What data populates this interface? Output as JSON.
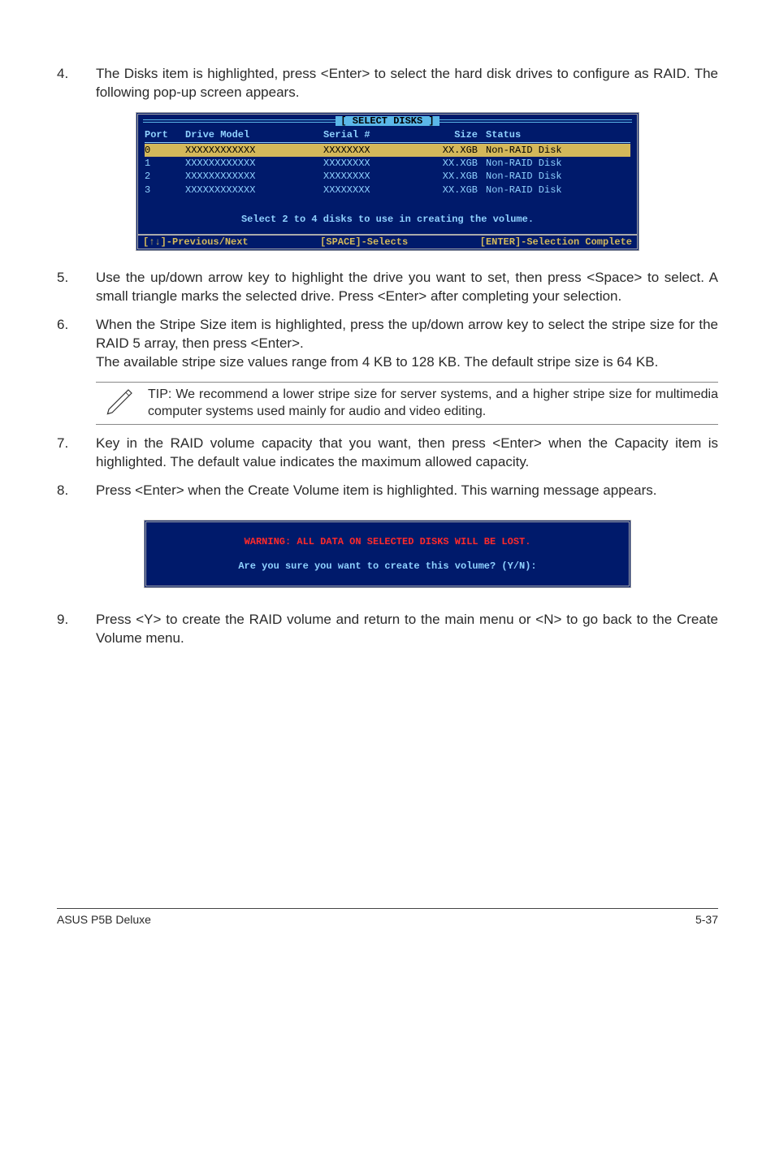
{
  "steps": {
    "s4": {
      "num": "4.",
      "text": "The Disks item is highlighted, press <Enter> to select the hard disk drives to configure as RAID. The following pop-up screen appears."
    },
    "s5": {
      "num": "5.",
      "text": "Use the up/down arrow key to highlight the drive you want to set, then press <Space> to select.  A small triangle marks the selected drive. Press <Enter> after completing your selection."
    },
    "s6": {
      "num": "6.",
      "text": "When the Stripe Size item is highlighted, press the up/down arrow key to select the stripe size for the RAID 5 array, then press <Enter>."
    },
    "s6b": "The available stripe size values range from 4 KB to 128 KB. The default stripe size is 64 KB.",
    "tip": "TIP: We recommend a lower stripe size for server systems, and a higher stripe size for multimedia computer systems used mainly for audio and video editing.",
    "s7": {
      "num": "7.",
      "text": "Key in the RAID volume capacity that you want, then press <Enter> when the Capacity item is highlighted. The default value indicates the maximum allowed capacity."
    },
    "s8": {
      "num": "8.",
      "text": "Press <Enter> when the Create Volume item is highlighted. This warning message appears."
    },
    "s9": {
      "num": "9.",
      "text": "Press <Y> to create the RAID volume and return to the main menu or <N> to go back to the Create Volume menu."
    }
  },
  "terminal": {
    "title": "[ SELECT DISKS ]",
    "headers": {
      "port": "Port",
      "model": "Drive Model",
      "serial": "Serial #",
      "size": "Size",
      "status": "Status"
    },
    "rows": [
      {
        "port": "0",
        "model": "XXXXXXXXXXXX",
        "serial": "XXXXXXXX",
        "size": "XX.XGB",
        "status": "Non-RAID Disk",
        "selected": true
      },
      {
        "port": "1",
        "model": "XXXXXXXXXXXX",
        "serial": "XXXXXXXX",
        "size": "XX.XGB",
        "status": "Non-RAID Disk",
        "selected": false
      },
      {
        "port": "2",
        "model": "XXXXXXXXXXXX",
        "serial": "XXXXXXXX",
        "size": "XX.XGB",
        "status": "Non-RAID Disk",
        "selected": false
      },
      {
        "port": "3",
        "model": "XXXXXXXXXXXX",
        "serial": "XXXXXXXX",
        "size": "XX.XGB",
        "status": "Non-RAID Disk",
        "selected": false
      }
    ],
    "note": "Select 2 to 4 disks to use in creating the volume.",
    "footer": {
      "left": "[↑↓]-Previous/Next",
      "mid": "[SPACE]-Selects",
      "right": "[ENTER]-Selection Complete"
    }
  },
  "warnbox": {
    "line1": "WARNING: ALL DATA ON SELECTED DISKS WILL BE LOST.",
    "line2": "Are you sure you want to create this volume? (Y/N):"
  },
  "footer": {
    "left": "ASUS P5B Deluxe",
    "right": "5-37"
  }
}
